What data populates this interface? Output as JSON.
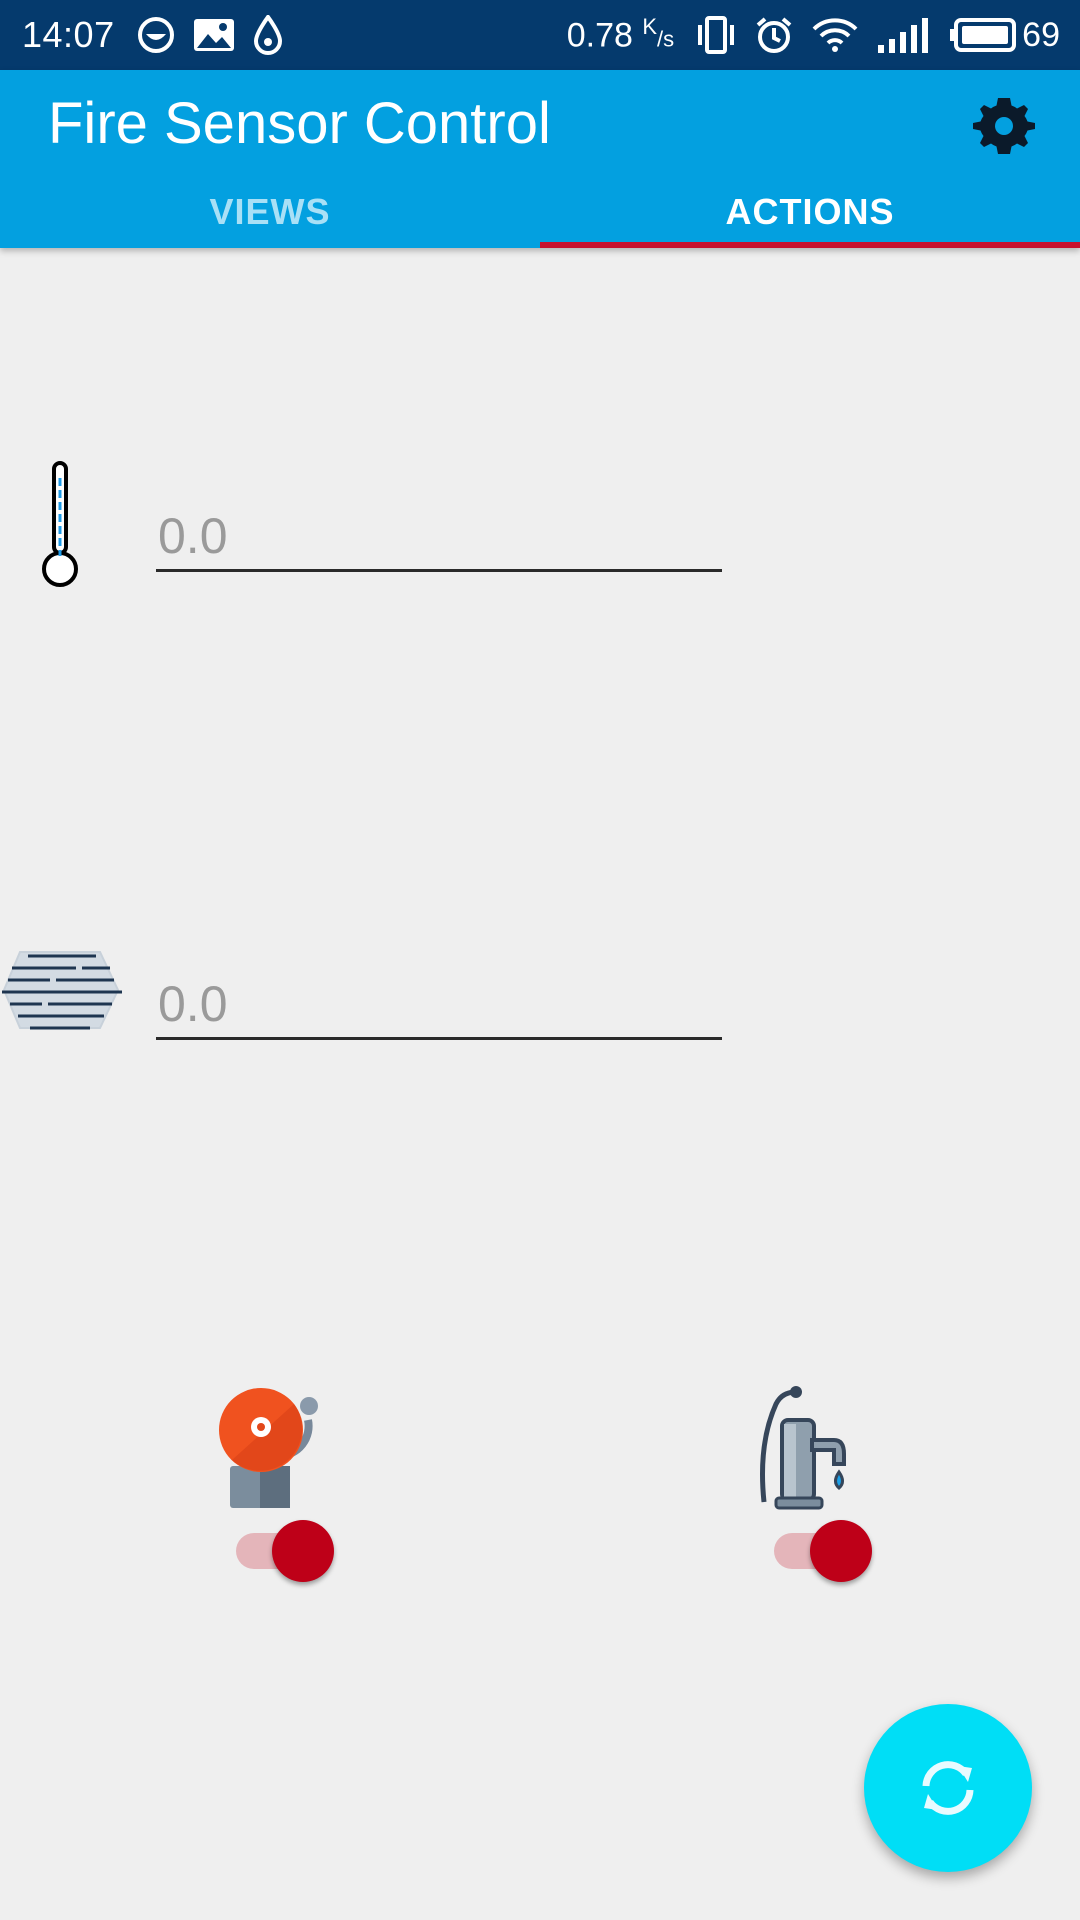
{
  "status_bar": {
    "time": "14:07",
    "speed_value": "0.78",
    "speed_unit_top": "K",
    "speed_unit_bottom": "/s",
    "battery_level": "69",
    "icons": [
      "face-icon",
      "image-icon",
      "drop-icon",
      "vibrate-icon",
      "alarm-icon",
      "wifi-icon",
      "signal-icon",
      "battery-icon"
    ]
  },
  "app_bar": {
    "title": "Fire Sensor Control",
    "settings_icon": "gear-icon",
    "background_color": "#03a0e0"
  },
  "tabs": [
    {
      "label": "VIEWS",
      "selected": false
    },
    {
      "label": "ACTIONS",
      "selected": true
    }
  ],
  "sensors": {
    "temperature": {
      "icon": "thermometer-icon",
      "value": "0.0"
    },
    "humidity": {
      "icon": "fog-icon",
      "value": "0.0"
    }
  },
  "actuators": {
    "alarm": {
      "icon": "alarm-bell-icon",
      "switch_on": true
    },
    "pump": {
      "icon": "water-pump-icon",
      "switch_on": true
    }
  },
  "fab": {
    "icon": "refresh-icon",
    "color": "#00def6"
  },
  "colors": {
    "status_bar": "#053a6d",
    "tab_indicator": "#c8102e",
    "switch_thumb": "#be0018",
    "switch_track": "#e4b5ba"
  }
}
